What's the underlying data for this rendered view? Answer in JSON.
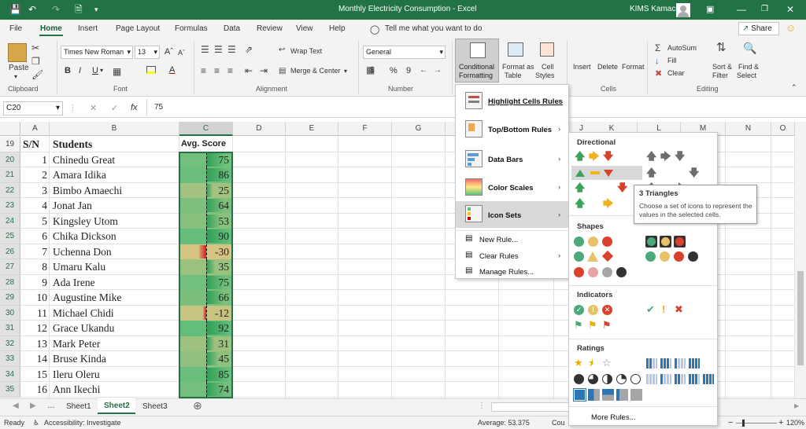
{
  "window": {
    "title": "Monthly Electricity Consumption  -  Excel",
    "user": "KIMS Kamac",
    "theme_color": "#217346"
  },
  "menu": {
    "tabs": [
      "File",
      "Home",
      "Insert",
      "Page Layout",
      "Formulas",
      "Data",
      "Review",
      "View",
      "Help"
    ],
    "active": "Home",
    "tell_me": "Tell me what you want to do",
    "share": "Share"
  },
  "ribbon": {
    "paste": "Paste",
    "clipboard": "Clipboard",
    "font_name": "Times New Roman",
    "font_size": "13",
    "font": "Font",
    "bold": "B",
    "italic": "I",
    "underline": "U",
    "wrap_text": "Wrap Text",
    "merge_center": "Merge & Center",
    "alignment": "Alignment",
    "number_format": "General",
    "number": "Number",
    "currency": "$",
    "percent": "%",
    "comma": "9",
    "conditional_formatting_1": "Conditional",
    "conditional_formatting_2": "Formatting",
    "format_table_1": "Format as",
    "format_table_2": "Table",
    "cell_styles_1": "Cell",
    "cell_styles_2": "Styles",
    "insert": "Insert",
    "delete": "Delete",
    "format": "Format",
    "cells": "Cells",
    "autosum": "AutoSum",
    "fill": "Fill",
    "clear": "Clear",
    "sort_filter_1": "Sort &",
    "sort_filter_2": "Filter",
    "find_select_1": "Find &",
    "find_select_2": "Select",
    "editing": "Editing"
  },
  "formula_bar": {
    "name_box": "C20",
    "fx": "fx",
    "value": "75"
  },
  "sheet": {
    "columns": [
      "A",
      "B",
      "C",
      "D",
      "E",
      "F",
      "G",
      "H",
      "I",
      "J",
      "K",
      "L",
      "M",
      "N",
      "O"
    ],
    "header_row_num": "19",
    "headers": {
      "a": "S/N",
      "b": "Students",
      "c": "Avg. Score"
    },
    "rows": [
      {
        "r": "20",
        "sn": "1",
        "name": "Chinedu Great",
        "score": 75
      },
      {
        "r": "21",
        "sn": "2",
        "name": "Amara Idika",
        "score": 86
      },
      {
        "r": "22",
        "sn": "3",
        "name": "Bimbo Amaechi",
        "score": 25
      },
      {
        "r": "23",
        "sn": "4",
        "name": "Jonat Jan",
        "score": 64
      },
      {
        "r": "24",
        "sn": "5",
        "name": "Kingsley Utom",
        "score": 53
      },
      {
        "r": "25",
        "sn": "6",
        "name": "Chika Dickson",
        "score": 90
      },
      {
        "r": "26",
        "sn": "7",
        "name": "Uchenna Don",
        "score": -30
      },
      {
        "r": "27",
        "sn": "8",
        "name": "Umaru Kalu",
        "score": 35
      },
      {
        "r": "28",
        "sn": "9",
        "name": "Ada Irene",
        "score": 75
      },
      {
        "r": "29",
        "sn": "10",
        "name": "Augustine Mike",
        "score": 66
      },
      {
        "r": "30",
        "sn": "11",
        "name": "Michael Chidi",
        "score": -12
      },
      {
        "r": "31",
        "sn": "12",
        "name": "Grace Ukandu",
        "score": 92
      },
      {
        "r": "32",
        "sn": "13",
        "name": "Mark Peter",
        "score": 31
      },
      {
        "r": "33",
        "sn": "14",
        "name": "Bruse Kinda",
        "score": 45
      },
      {
        "r": "34",
        "sn": "15",
        "name": "Ileru Oleru",
        "score": 85
      },
      {
        "r": "35",
        "sn": "16",
        "name": "Ann Ikechi",
        "score": 74
      }
    ]
  },
  "sheet_tabs": [
    "Sheet1",
    "Sheet2",
    "Sheet3"
  ],
  "active_sheet": "Sheet2",
  "status": {
    "ready": "Ready",
    "accessibility": "Accessibility: Investigate",
    "average": "Average: 53.375",
    "count": "Cou",
    "zoom": "120%"
  },
  "cf_menu": {
    "items": [
      "Highlight Cells Rules",
      "Top/Bottom Rules",
      "Data Bars",
      "Color Scales",
      "Icon Sets",
      "New Rule...",
      "Clear Rules",
      "Manage Rules..."
    ]
  },
  "icon_sets": {
    "directional": "Directional",
    "shapes": "Shapes",
    "indicators": "Indicators",
    "ratings": "Ratings",
    "more_rules": "More Rules...",
    "exclaim": "!",
    "tooltip_title": "3 Triangles",
    "tooltip_body": "Choose a set of icons to represent the values in the selected cells."
  }
}
